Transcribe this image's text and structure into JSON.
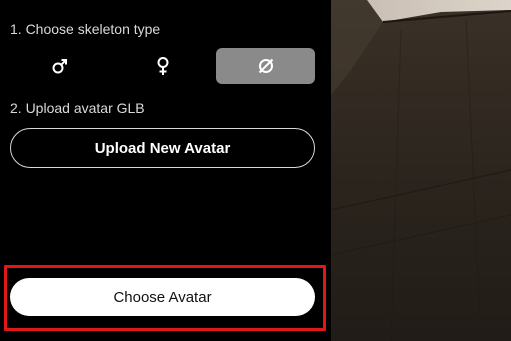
{
  "sidebar": {
    "step1_label": "1. Choose skeleton type",
    "skeleton_options": [
      {
        "name": "male",
        "icon": "male-icon",
        "selected": false
      },
      {
        "name": "female",
        "icon": "female-icon",
        "selected": false
      },
      {
        "name": "none",
        "icon": "empty-set-icon",
        "selected": true
      }
    ],
    "step2_label": "2. Upload avatar GLB",
    "upload_label": "Upload New Avatar",
    "choose_label": "Choose Avatar"
  },
  "colors": {
    "highlight": "#e01818",
    "selected_option": "#8a8a8a"
  }
}
